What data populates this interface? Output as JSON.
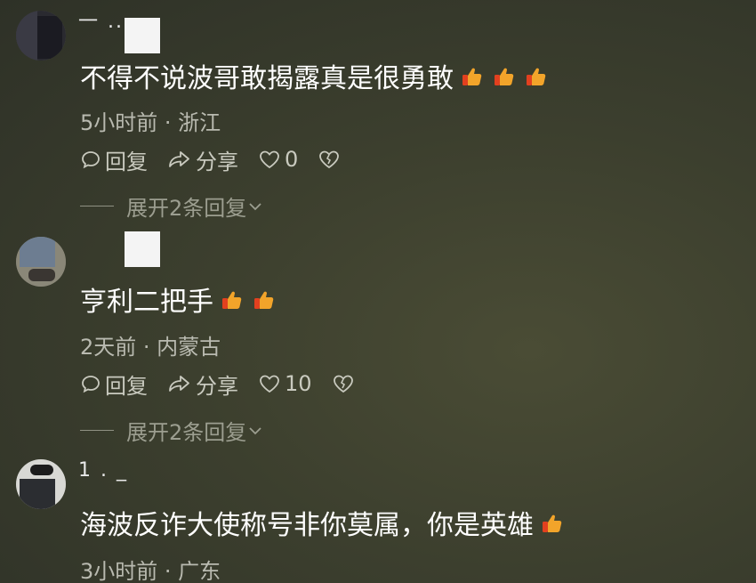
{
  "comments": [
    {
      "name_fragment": "一 .. .",
      "text": "不得不说波哥敢揭露真是很勇敢",
      "thumbs": 3,
      "meta": "5小时前 · 浙江",
      "reply_label": "回复",
      "share_label": "分享",
      "likes": "0",
      "expand_label": "展开2条回复"
    },
    {
      "text": "亨利二把手",
      "thumbs": 2,
      "meta": "2天前 · 内蒙古",
      "reply_label": "回复",
      "share_label": "分享",
      "likes": "10",
      "expand_label": "展开2条回复"
    },
    {
      "name_fragment": "1 . _",
      "text": "海波反诈大使称号非你莫属，你是英雄",
      "thumbs": 1,
      "meta": "3小时前 · 广东"
    }
  ],
  "colors": {
    "background": "#3c3f2e",
    "text": "#ffffff",
    "meta": "#b9bab0",
    "thumb": "#f2a42a"
  },
  "icons": [
    "comment-icon",
    "share-icon",
    "heart-icon",
    "broken-heart-icon",
    "chevron-down-icon",
    "thumbs-up-emoji"
  ]
}
